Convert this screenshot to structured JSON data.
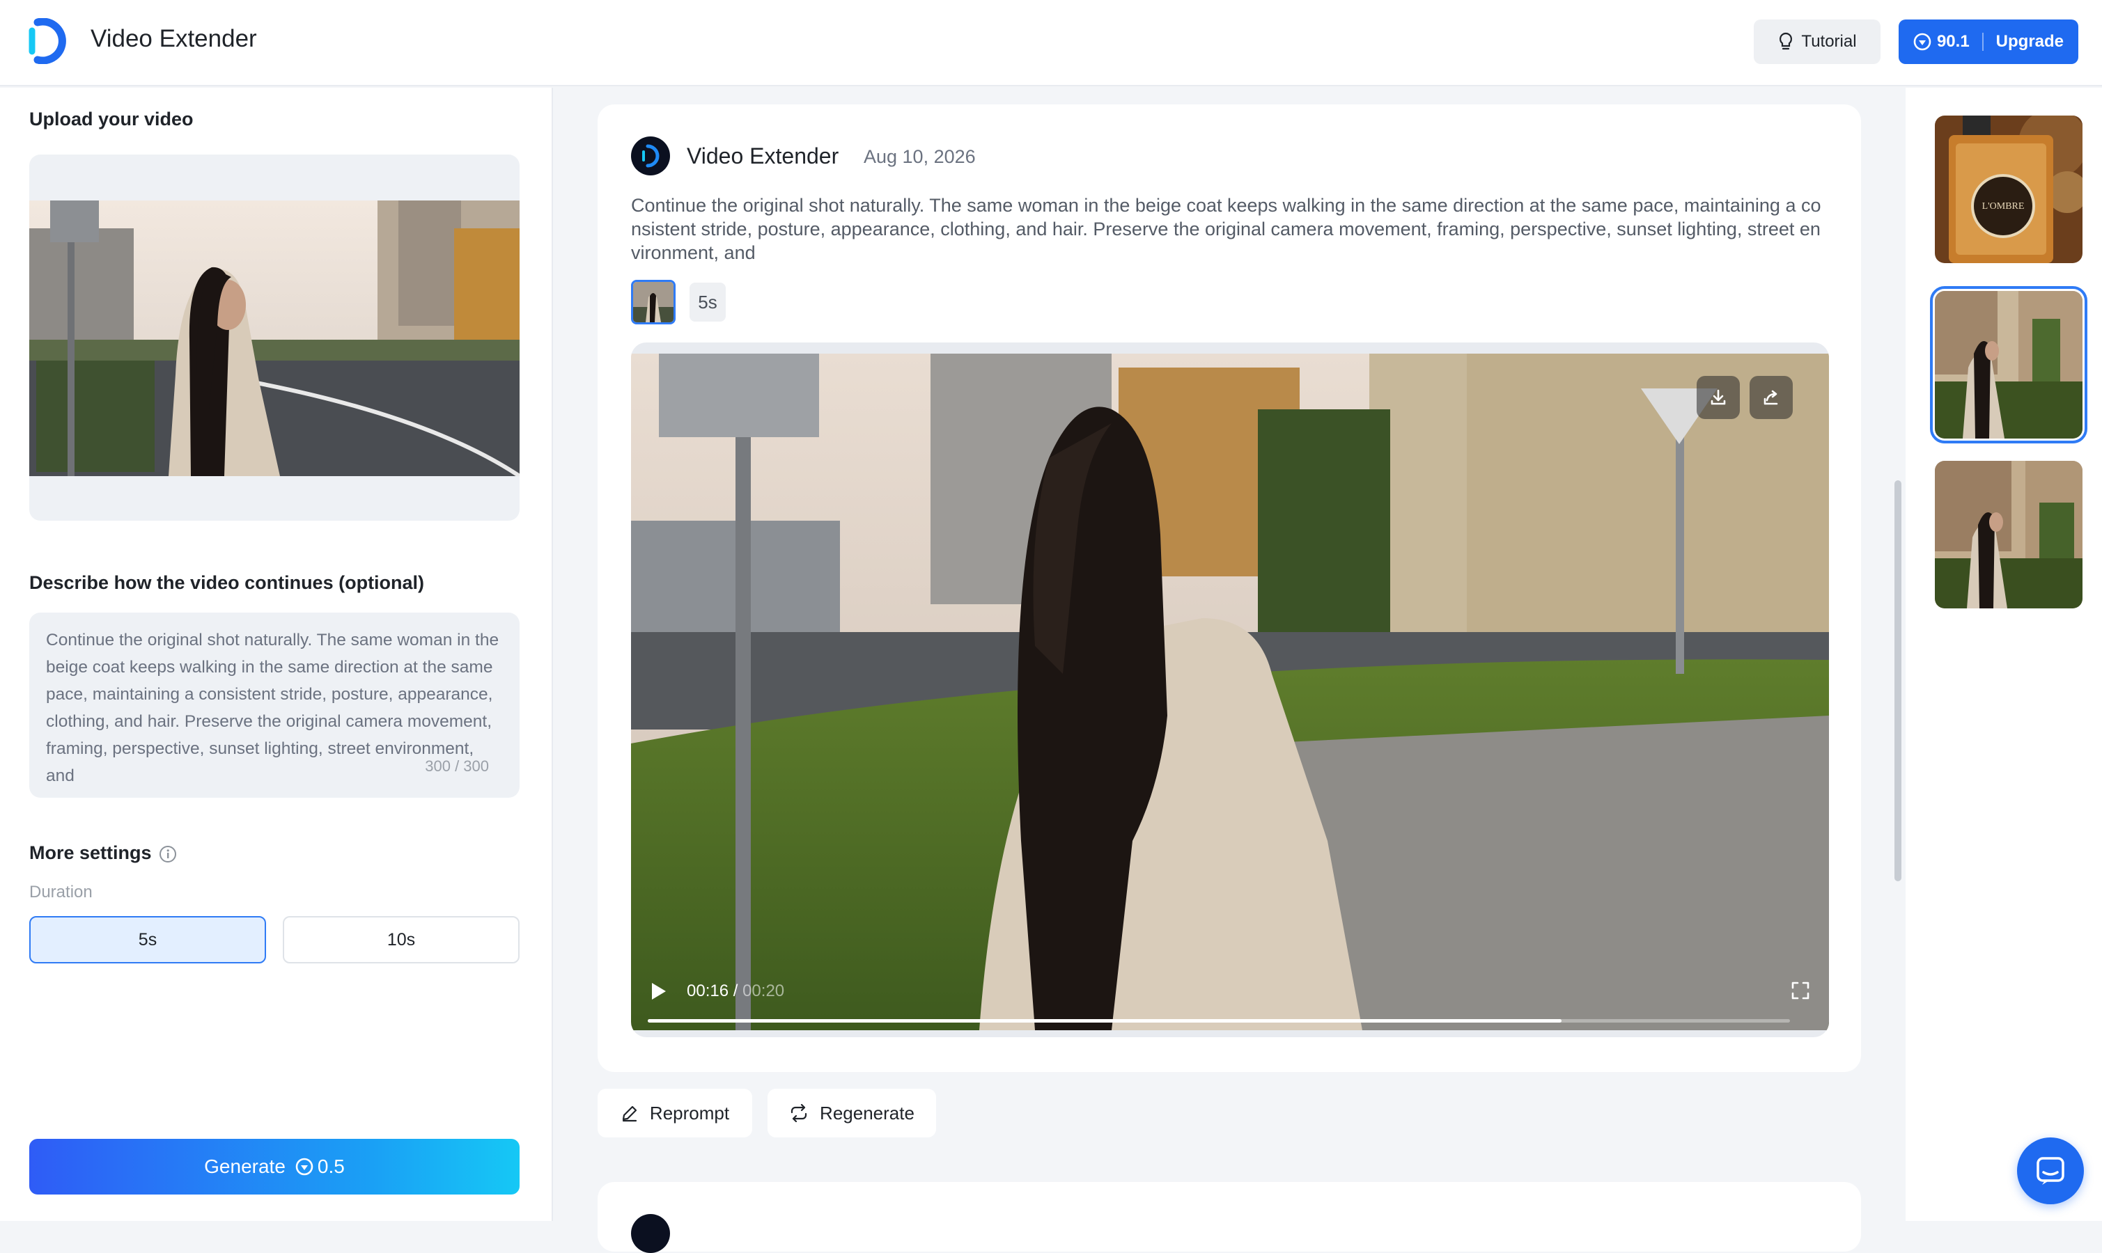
{
  "app": {
    "title": "Video Extender"
  },
  "header": {
    "tutorial_label": "Tutorial",
    "credits": "90.1",
    "upgrade_label": "Upgrade"
  },
  "left": {
    "upload_label": "Upload your video",
    "describe_label": "Describe how the video continues (optional)",
    "prompt_text": "Continue the original shot naturally. The same woman in the beige coat keeps walking in the same direction at the same pace, maintaining a consistent stride, posture, appearance, clothing, and hair. Preserve the original camera movement, framing, perspective, sunset lighting, street environment, and",
    "char_counter": "300 / 300",
    "more_settings_label": "More settings",
    "duration_label": "Duration",
    "duration_options": [
      "5s",
      "10s"
    ],
    "duration_selected": "5s",
    "generate_label": "Generate",
    "generate_cost": "0.5"
  },
  "feed": {
    "card": {
      "app_name": "Video Extender",
      "date": "Aug 10, 2026",
      "prompt": "Continue the original shot naturally. The same woman in the beige coat keeps walking in the same direction at the same pace, maintaining a consistent stride, posture, appearance, clothing, and hair. Preserve the original camera movement, framing, perspective, sunset lighting, street environment, and",
      "duration_badge": "5s",
      "player": {
        "current_time": "00:16",
        "total_time": "00:20",
        "progress": 0.8
      }
    },
    "actions": {
      "reprompt": "Reprompt",
      "regenerate": "Regenerate"
    }
  },
  "history": {
    "items": [
      {
        "name": "perfume-bottle",
        "selected": false
      },
      {
        "name": "woman-beige-coat-street",
        "selected": true
      },
      {
        "name": "woman-beige-coat-street-alt",
        "selected": false
      }
    ]
  },
  "colors": {
    "accent": "#1f6af0",
    "selected_border": "#2f7bf5",
    "generate_gradient_start": "#2f5cf6",
    "generate_gradient_end": "#16c8f5"
  }
}
